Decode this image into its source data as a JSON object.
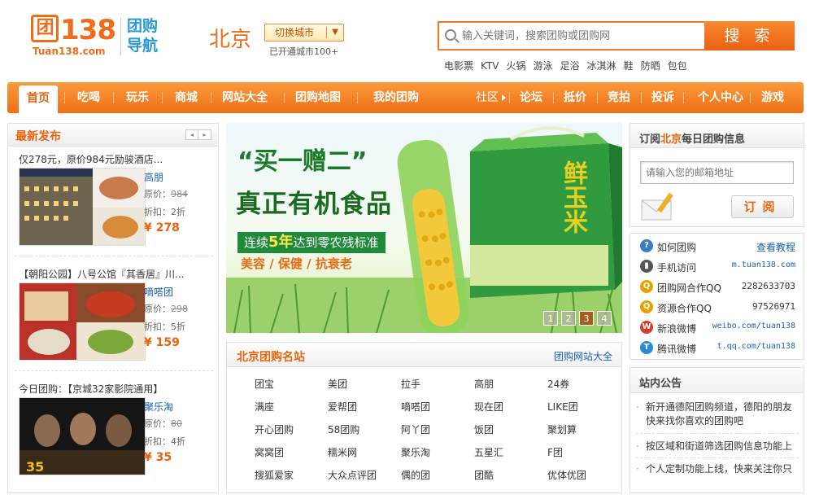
{
  "header": {
    "logo_char": "团",
    "logo_digits": "138",
    "logo_domain": "Tuan138.com",
    "logo_nav": "团购导航",
    "city": "北京",
    "switch_city": "切换城市",
    "city_count": "已开通城市100+",
    "search_placeholder": "输入关键词，搜索团购或团购网",
    "search_button": "搜 索",
    "hot_keywords": [
      "电影票",
      "KTV",
      "火锅",
      "游泳",
      "足浴",
      "冰淇淋",
      "鞋",
      "防晒",
      "包包"
    ]
  },
  "nav": {
    "left": [
      "首页",
      "吃喝",
      "玩乐",
      "商城",
      "网站大全",
      "团购地图",
      "我的团购"
    ],
    "community": "社区",
    "right": [
      "论坛",
      "抵价",
      "竞拍",
      "投诉",
      "个人中心",
      "游戏"
    ]
  },
  "latest": {
    "title": "最新发布",
    "prev": "◂",
    "next": "▸",
    "orig_label": "原价：",
    "disc_label": "折扣：",
    "deals": [
      {
        "title": "仅278元，原价984元励骏酒店...",
        "site": "高朋",
        "orig": "984",
        "discount": "2折",
        "price": "¥ 278"
      },
      {
        "title": "【朝阳公园】八号公馆『其香居』川...",
        "site": "嘀嗒团",
        "orig": "298",
        "discount": "5折",
        "price": "¥ 159"
      },
      {
        "title": "今日团购：【京城32家影院通用】",
        "site": "聚乐淘",
        "orig": "80",
        "discount": "4折",
        "price": "¥ 35"
      }
    ]
  },
  "banner": {
    "line1": "“买一赠二”",
    "line2": "真正有机食品",
    "line3_pre": "连续",
    "line3_num": "5年",
    "line3_post": "达到零农残标准",
    "line4": "美容 / 保健 / 抗衰老",
    "box_text": "鲜玉米",
    "dots": [
      "1",
      "2",
      "3",
      "4"
    ],
    "active_dot": 2
  },
  "sites": {
    "title": "北京团购名站",
    "more": "团购网站大全",
    "rows": [
      [
        "团宝",
        "美团",
        "拉手",
        "高朋",
        "24券"
      ],
      [
        "满座",
        "爱帮团",
        "嘀嗒团",
        "现在团",
        "LIKE团"
      ],
      [
        "开心团购",
        "58团购",
        "阿丫团",
        "饭团",
        "聚划算"
      ],
      [
        "窝窝团",
        "糯米网",
        "聚乐淘",
        "五星汇",
        "F团"
      ],
      [
        "搜狐爱家",
        "大众点评团",
        "偶的团",
        "团酷",
        "优体优团"
      ]
    ]
  },
  "subscribe": {
    "title_pre": "订阅",
    "title_city": "北京",
    "title_post": "每日团购信息",
    "email_placeholder": "请输入您的邮箱地址",
    "button": "订阅"
  },
  "info": [
    {
      "icon": "?",
      "label": "如何团购",
      "value": "查看教程",
      "kind": "link",
      "color": "#3a7cc6",
      "icon_name": "help-icon"
    },
    {
      "icon": "▮",
      "label": "手机访问",
      "value": "m.tuan138.com",
      "kind": "url",
      "color": "#555555",
      "icon_name": "mobile-icon"
    },
    {
      "icon": "Q",
      "label": "团购网合作QQ",
      "value": "2282633703",
      "kind": "plain",
      "color": "#e8a000",
      "icon_name": "qq-icon"
    },
    {
      "icon": "Q",
      "label": "资源合作QQ",
      "value": "97526971",
      "kind": "plain",
      "color": "#e8a000",
      "icon_name": "qq-icon"
    },
    {
      "icon": "W",
      "label": "新浪微博",
      "value": "weibo.com/tuan138",
      "kind": "url",
      "color": "#d83a2a",
      "icon_name": "weibo-icon"
    },
    {
      "icon": "T",
      "label": "腾讯微博",
      "value": "t.qq.com/tuan138",
      "kind": "url",
      "color": "#2a8ad6",
      "icon_name": "tencent-weibo-icon"
    }
  ],
  "notices": {
    "title": "站内公告",
    "items": [
      "新开通德阳团购频道，德阳的朋友快来找你喜欢的团购吧",
      "按区域和街道筛选团购信息功能上",
      "个人定制功能上线，快来关注你只"
    ]
  },
  "colors": {
    "brand": "#ee6c1c",
    "link": "#1a5fb0",
    "nav_from": "#fb9a3c",
    "nav_to": "#ef6f17"
  }
}
